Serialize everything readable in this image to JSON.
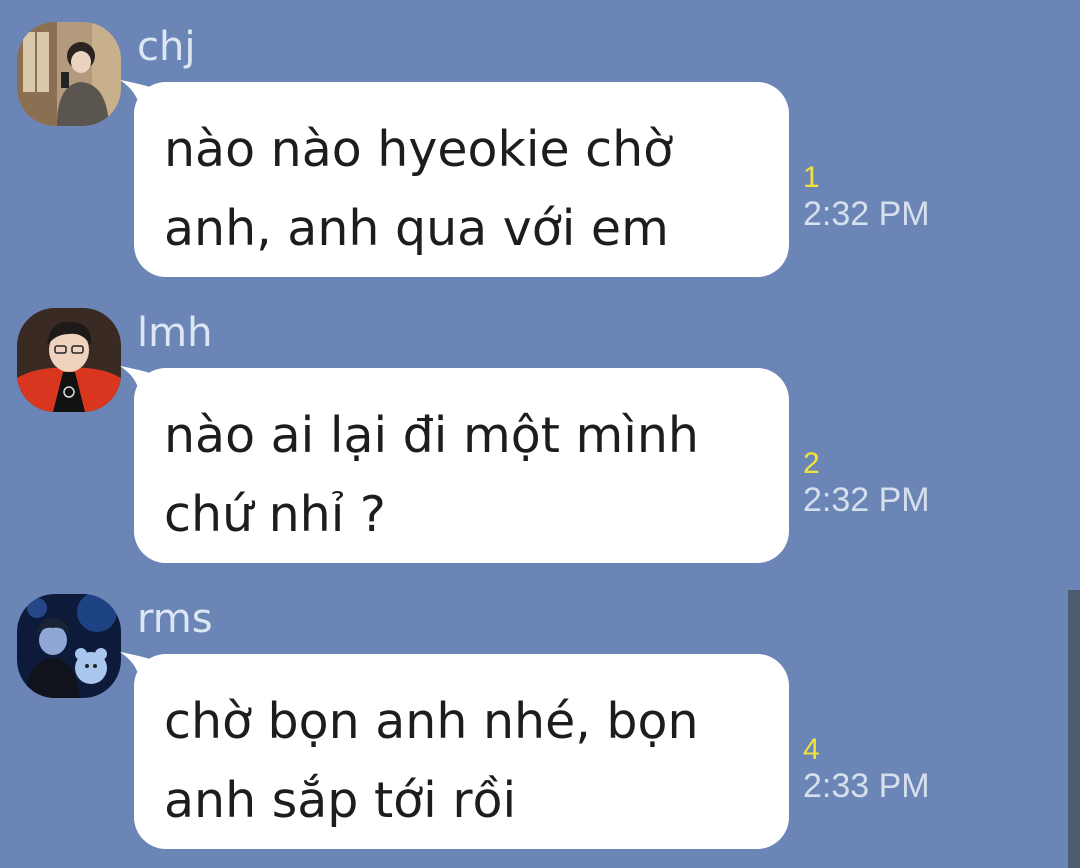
{
  "colors": {
    "background": "#6b86b6",
    "bubble": "#ffffff",
    "unread": "#f2e33a",
    "time": "#d6dfec",
    "sender": "#dde6f3"
  },
  "messages": [
    {
      "sender": "chj",
      "avatar_icon": "user-avatar-icon",
      "text": "nào nào hyeokie chờ\nanh, anh qua với em",
      "unread_count": "1",
      "time": "2:32 PM"
    },
    {
      "sender": "lmh",
      "avatar_icon": "user-avatar-icon",
      "text": "nào ai lại đi một mình\nchứ nhỉ ?",
      "unread_count": "2",
      "time": "2:32 PM"
    },
    {
      "sender": "rms",
      "avatar_icon": "user-avatar-icon",
      "text": "chờ bọn anh nhé, bọn\nanh sắp tới rồi",
      "unread_count": "4",
      "time": "2:33 PM"
    }
  ]
}
